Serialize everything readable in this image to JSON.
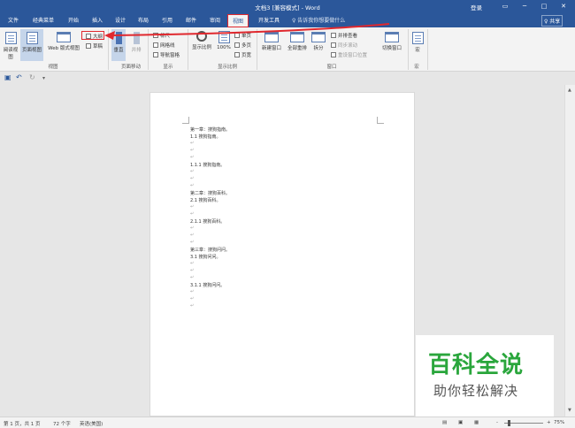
{
  "titlebar": {
    "title": "文档3 [兼容模式] - Word",
    "login": "登录",
    "minimize": "─",
    "restore": "▭",
    "maximize": "□",
    "close": "✕"
  },
  "tabs": [
    "文件",
    "经典菜单",
    "开始",
    "插入",
    "设计",
    "布局",
    "引用",
    "邮件",
    "审阅",
    "视图",
    "开发工具"
  ],
  "active_tab": "视图",
  "tellme_placeholder": "♀ 告诉我你想要做什么",
  "share_label": "♀ 共享",
  "ribbon": {
    "views": {
      "read_mode": "阅读视图",
      "print_layout": "页面视图",
      "web_layout": "Web 版式视图",
      "outline": "大纲",
      "draft": "草稿",
      "label": "视图"
    },
    "page_move": {
      "vertical": "垂直",
      "side_to_side": "并排",
      "label": "页面移动"
    },
    "show": {
      "ruler": "标尺",
      "gridlines": "网格线",
      "nav_pane": "导航窗格",
      "label": "显示"
    },
    "zoom": {
      "zoom": "显示比例",
      "hundred": "100%",
      "one_page": "单页",
      "multi_page": "多页",
      "page_width": "页宽",
      "label": "显示比例"
    },
    "window": {
      "new_window": "新建窗口",
      "arrange_all": "全部重排",
      "split": "拆分",
      "side_by_side": "并排查看",
      "sync_scroll": "同步滚动",
      "reset_pos": "重设窗口位置",
      "switch": "切换窗口",
      "label": "窗口"
    },
    "macros": {
      "macro": "宏",
      "label": "宏"
    }
  },
  "document_lines": [
    "第一章：搜狗指南。",
    "1.1 搜狗指南。",
    "",
    "",
    "",
    "1.1.1 搜狗指南。",
    "",
    "",
    "",
    "第二章：搜狗百科。",
    "2.1 搜狗百科。",
    "",
    "",
    "2.1.1 搜狗百科。",
    "",
    "",
    "",
    "第三章：搜狗问问。",
    "3.1 搜狗问问。",
    "",
    "",
    "",
    "3.1.1 搜狗问问。",
    "",
    "",
    ""
  ],
  "watermark": {
    "title": "百科全说",
    "subtitle": "助你轻松解决"
  },
  "statusbar": {
    "page": "第 1 页，共 1 页",
    "words": "72 个字",
    "language": "英语(美国)",
    "zoom": "75%",
    "zoom_minus": "-",
    "zoom_plus": "+"
  },
  "colors": {
    "titlebar": "#2b579a",
    "highlight": "#e0282e",
    "watermark_green": "#2aa63c"
  }
}
